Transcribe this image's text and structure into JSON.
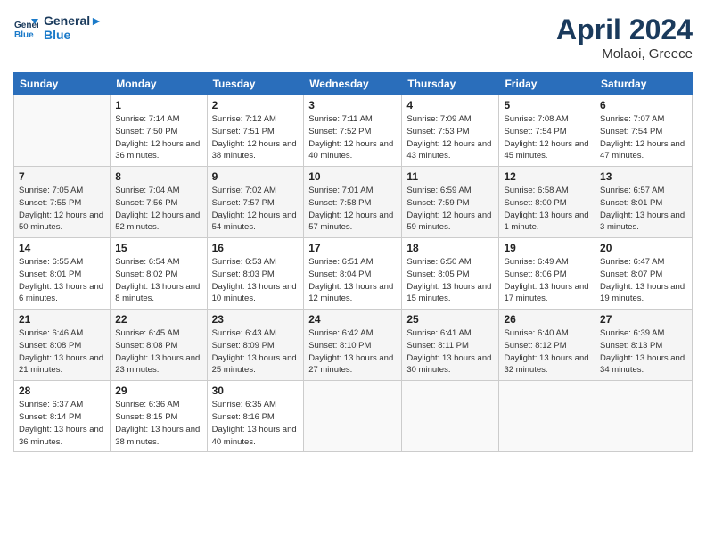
{
  "header": {
    "logo_line1": "General",
    "logo_line2": "Blue",
    "month": "April 2024",
    "location": "Molaoi, Greece"
  },
  "weekdays": [
    "Sunday",
    "Monday",
    "Tuesday",
    "Wednesday",
    "Thursday",
    "Friday",
    "Saturday"
  ],
  "weeks": [
    [
      {
        "day": "",
        "empty": true
      },
      {
        "day": "1",
        "sunrise": "7:14 AM",
        "sunset": "7:50 PM",
        "daylight": "12 hours and 36 minutes."
      },
      {
        "day": "2",
        "sunrise": "7:12 AM",
        "sunset": "7:51 PM",
        "daylight": "12 hours and 38 minutes."
      },
      {
        "day": "3",
        "sunrise": "7:11 AM",
        "sunset": "7:52 PM",
        "daylight": "12 hours and 40 minutes."
      },
      {
        "day": "4",
        "sunrise": "7:09 AM",
        "sunset": "7:53 PM",
        "daylight": "12 hours and 43 minutes."
      },
      {
        "day": "5",
        "sunrise": "7:08 AM",
        "sunset": "7:54 PM",
        "daylight": "12 hours and 45 minutes."
      },
      {
        "day": "6",
        "sunrise": "7:07 AM",
        "sunset": "7:54 PM",
        "daylight": "12 hours and 47 minutes."
      }
    ],
    [
      {
        "day": "7",
        "sunrise": "7:05 AM",
        "sunset": "7:55 PM",
        "daylight": "12 hours and 50 minutes."
      },
      {
        "day": "8",
        "sunrise": "7:04 AM",
        "sunset": "7:56 PM",
        "daylight": "12 hours and 52 minutes."
      },
      {
        "day": "9",
        "sunrise": "7:02 AM",
        "sunset": "7:57 PM",
        "daylight": "12 hours and 54 minutes."
      },
      {
        "day": "10",
        "sunrise": "7:01 AM",
        "sunset": "7:58 PM",
        "daylight": "12 hours and 57 minutes."
      },
      {
        "day": "11",
        "sunrise": "6:59 AM",
        "sunset": "7:59 PM",
        "daylight": "12 hours and 59 minutes."
      },
      {
        "day": "12",
        "sunrise": "6:58 AM",
        "sunset": "8:00 PM",
        "daylight": "13 hours and 1 minute."
      },
      {
        "day": "13",
        "sunrise": "6:57 AM",
        "sunset": "8:01 PM",
        "daylight": "13 hours and 3 minutes."
      }
    ],
    [
      {
        "day": "14",
        "sunrise": "6:55 AM",
        "sunset": "8:01 PM",
        "daylight": "13 hours and 6 minutes."
      },
      {
        "day": "15",
        "sunrise": "6:54 AM",
        "sunset": "8:02 PM",
        "daylight": "13 hours and 8 minutes."
      },
      {
        "day": "16",
        "sunrise": "6:53 AM",
        "sunset": "8:03 PM",
        "daylight": "13 hours and 10 minutes."
      },
      {
        "day": "17",
        "sunrise": "6:51 AM",
        "sunset": "8:04 PM",
        "daylight": "13 hours and 12 minutes."
      },
      {
        "day": "18",
        "sunrise": "6:50 AM",
        "sunset": "8:05 PM",
        "daylight": "13 hours and 15 minutes."
      },
      {
        "day": "19",
        "sunrise": "6:49 AM",
        "sunset": "8:06 PM",
        "daylight": "13 hours and 17 minutes."
      },
      {
        "day": "20",
        "sunrise": "6:47 AM",
        "sunset": "8:07 PM",
        "daylight": "13 hours and 19 minutes."
      }
    ],
    [
      {
        "day": "21",
        "sunrise": "6:46 AM",
        "sunset": "8:08 PM",
        "daylight": "13 hours and 21 minutes."
      },
      {
        "day": "22",
        "sunrise": "6:45 AM",
        "sunset": "8:08 PM",
        "daylight": "13 hours and 23 minutes."
      },
      {
        "day": "23",
        "sunrise": "6:43 AM",
        "sunset": "8:09 PM",
        "daylight": "13 hours and 25 minutes."
      },
      {
        "day": "24",
        "sunrise": "6:42 AM",
        "sunset": "8:10 PM",
        "daylight": "13 hours and 27 minutes."
      },
      {
        "day": "25",
        "sunrise": "6:41 AM",
        "sunset": "8:11 PM",
        "daylight": "13 hours and 30 minutes."
      },
      {
        "day": "26",
        "sunrise": "6:40 AM",
        "sunset": "8:12 PM",
        "daylight": "13 hours and 32 minutes."
      },
      {
        "day": "27",
        "sunrise": "6:39 AM",
        "sunset": "8:13 PM",
        "daylight": "13 hours and 34 minutes."
      }
    ],
    [
      {
        "day": "28",
        "sunrise": "6:37 AM",
        "sunset": "8:14 PM",
        "daylight": "13 hours and 36 minutes."
      },
      {
        "day": "29",
        "sunrise": "6:36 AM",
        "sunset": "8:15 PM",
        "daylight": "13 hours and 38 minutes."
      },
      {
        "day": "30",
        "sunrise": "6:35 AM",
        "sunset": "8:16 PM",
        "daylight": "13 hours and 40 minutes."
      },
      {
        "day": "",
        "empty": true
      },
      {
        "day": "",
        "empty": true
      },
      {
        "day": "",
        "empty": true
      },
      {
        "day": "",
        "empty": true
      }
    ]
  ],
  "labels": {
    "sunrise": "Sunrise:",
    "sunset": "Sunset:",
    "daylight": "Daylight:"
  }
}
